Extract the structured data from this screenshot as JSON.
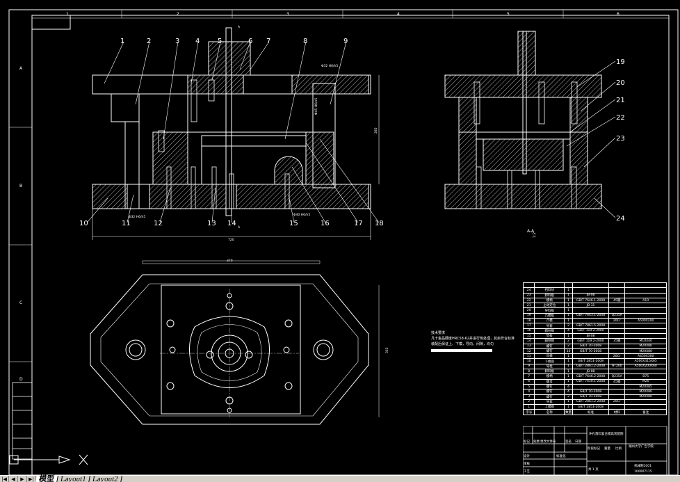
{
  "app": {
    "tabs": [
      {
        "label": "模型",
        "active": true
      },
      {
        "label": "Layout1"
      },
      {
        "label": "Layout2"
      }
    ],
    "nav_buttons": [
      "first",
      "prev",
      "next",
      "last"
    ]
  },
  "frame": {
    "columns": [
      "1",
      "2",
      "3",
      "4",
      "5",
      "6"
    ],
    "rows": [
      "A",
      "B",
      "C",
      "D"
    ]
  },
  "front_view": {
    "labels_top": [
      "1",
      "2",
      "3",
      "4",
      "5",
      "6",
      "7",
      "8",
      "9"
    ],
    "labels_bottom": [
      "10",
      "11",
      "12",
      "13",
      "14",
      "15",
      "16",
      "17",
      "18"
    ],
    "section_mark": "A",
    "fits": [
      "Φ32 H6/h5",
      "Φ45 H6/n5",
      "Φ32 H6/h5",
      "Φ40 H6/h5"
    ],
    "dim_height": "285",
    "dim_width": "720"
  },
  "side_view": {
    "labels": [
      "19",
      "20",
      "21",
      "22",
      "23",
      "24"
    ],
    "section_title": "A-A",
    "scale": "1:2"
  },
  "plan_view": {
    "dim_width": "370",
    "dim_height": "355"
  },
  "tech_requirements": {
    "title": "技术要求",
    "lines": [
      "凡十金品硬度HRC58-62并进行热处理，其余符合标准",
      "装配后保证上、下模，导向，间隙，均匀"
    ]
  },
  "parts_list": {
    "header": [
      "序号",
      "名称",
      "数量",
      "标准",
      "材料",
      "备注"
    ],
    "rows": [
      [
        "24",
        "挡料块",
        "1",
        "",
        "",
        ""
      ],
      [
        "23",
        "卸料板",
        "1",
        "JB-08",
        "",
        ""
      ],
      [
        "22",
        "模柄",
        "1",
        "GB/T 7646.1-2008",
        "45钢",
        "A10"
      ],
      [
        "21",
        "止动定位",
        "1",
        "JB-31",
        "",
        ""
      ],
      [
        "20",
        "导料板",
        "1",
        "",
        "",
        ""
      ],
      [
        "19",
        "凸模板",
        "1",
        "GB/T 7643.1-2008",
        "Q235A",
        ""
      ],
      [
        "18",
        "凸模",
        "1",
        "",
        "20Cr",
        "A500X200"
      ],
      [
        "17",
        "导套",
        "2",
        "GB/T 7861.5-2008",
        "",
        ""
      ],
      [
        "16",
        "圆柱销",
        "4",
        "GB/T 119.2-2000",
        "",
        ""
      ],
      [
        "15",
        "垫板",
        "1",
        "JB-08",
        "",
        ""
      ],
      [
        "14",
        "圆柱销",
        "2",
        "GB/T 119.2-2000",
        "35钢",
        "M10X40"
      ],
      [
        "13",
        "螺钉",
        "2",
        "GB/T 70-2008",
        "",
        "M20X80"
      ],
      [
        "12",
        "螺钉",
        "10",
        "GB/T 70-2008",
        "",
        "M20X80"
      ],
      [
        "11",
        "凹模",
        "1",
        "",
        "20Cr",
        "A450X300"
      ],
      [
        "10",
        "下模座",
        "1",
        "GB/T 2851-2008",
        "",
        "A500X315X65"
      ],
      [
        "9",
        "导柱",
        "1",
        "GB/T 2861.2-2008",
        "HT200",
        "A500X200X60"
      ],
      [
        "8",
        "卸料板",
        "1",
        "JB-08",
        "",
        ""
      ],
      [
        "7",
        "模柄",
        "1",
        "GB/T 7646.2-2008",
        "Q235A",
        "B75"
      ],
      [
        "6",
        "螺母",
        "1",
        "GB/T 7650.1-2008",
        "45钢",
        "M20"
      ],
      [
        "5",
        "螺钉",
        "4",
        "",
        "",
        "M20X85"
      ],
      [
        "4",
        "螺钉",
        "4",
        "GB/T 70-2008",
        "",
        "M20X80"
      ],
      [
        "3",
        "螺钉",
        "2",
        "GB/T 70-2008",
        "",
        "M20X80"
      ],
      [
        "2",
        "导套",
        "1",
        "GB/T 2861.2-2008",
        "20Cr",
        ""
      ],
      [
        "1",
        "上模座",
        "1",
        "GB/T 2851-2008",
        "",
        ""
      ]
    ]
  },
  "title_block": {
    "design_label": "设计",
    "design_name": "学号",
    "material_label": "材料",
    "remark": "备注",
    "drawing_title": "冲孔落料复合模具装配图",
    "school": "湖州大学广告学院",
    "drawing_no": "机械制1001",
    "id_no": "100007115",
    "scale_label": "比例",
    "stage_label": "阶段标记",
    "weight_label": "重量",
    "sheet": "共 1 页",
    "rows_left": [
      "标记",
      "处数",
      "更改文件号",
      "签名",
      "日期"
    ],
    "roles": [
      "设计",
      "审核",
      "工艺"
    ],
    "standardize": "标准化"
  },
  "colors": {
    "background": "#000000",
    "lines": "#ffffff",
    "tabbar": "#d4d0c8"
  }
}
